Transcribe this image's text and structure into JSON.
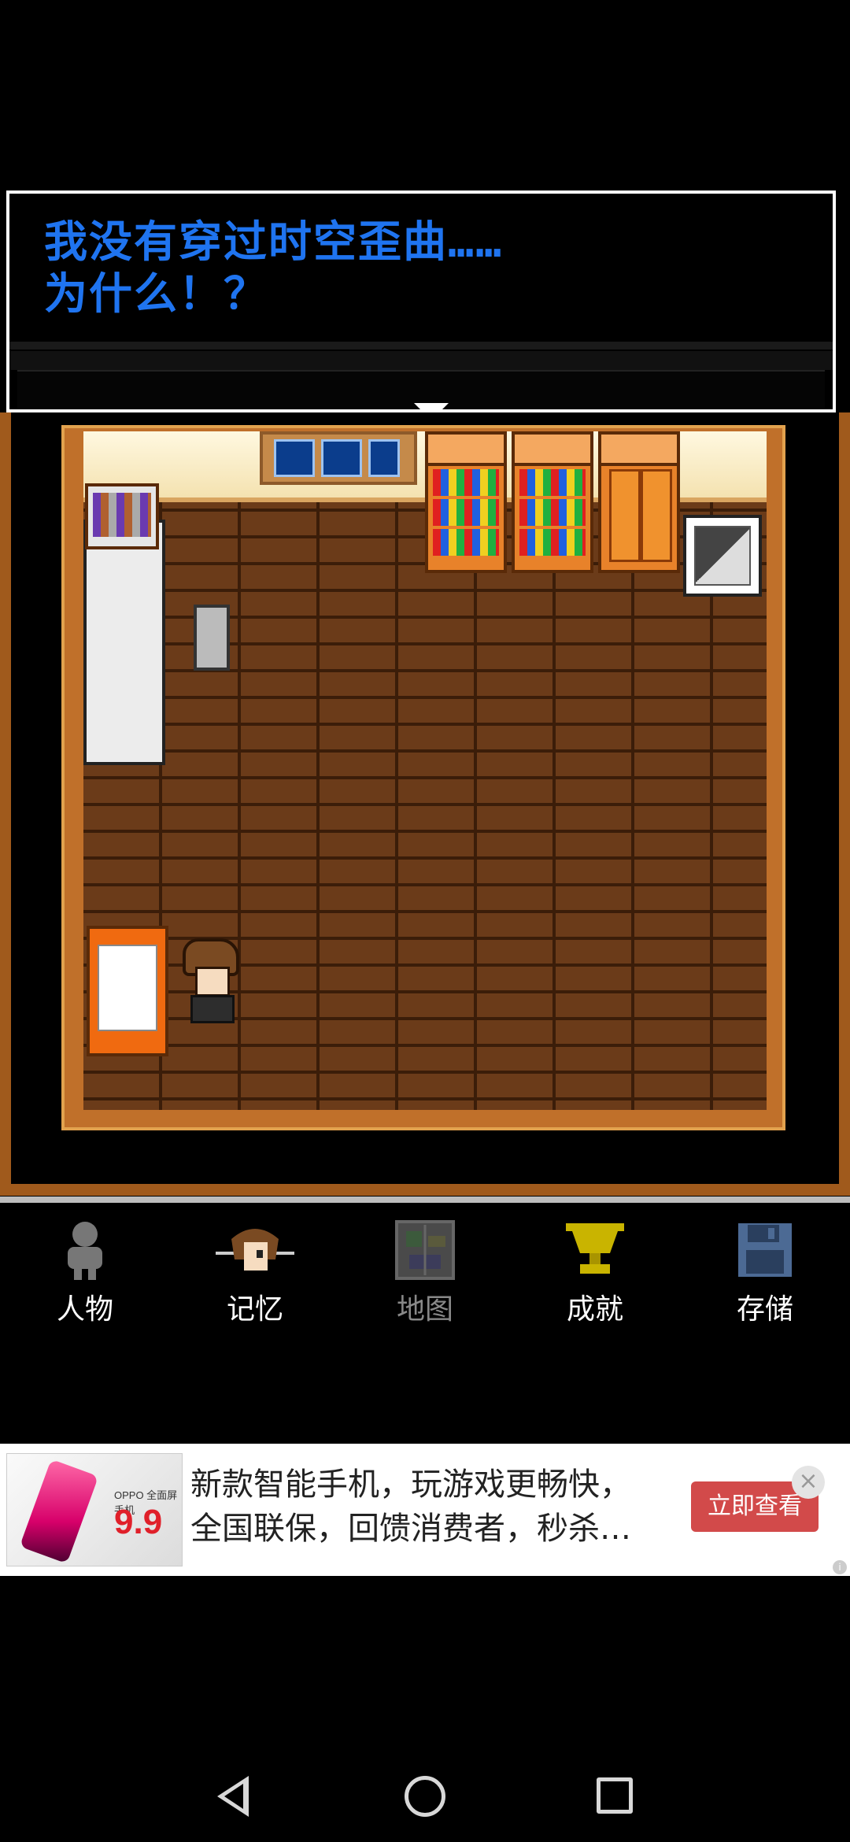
{
  "dialog": {
    "line1": "我没有穿过时空歪曲……",
    "line2": "为什么！？"
  },
  "menu": {
    "items": [
      {
        "label": "人物",
        "icon": "character-icon",
        "enabled": true
      },
      {
        "label": "记忆",
        "icon": "memory-icon",
        "enabled": true
      },
      {
        "label": "地图",
        "icon": "map-icon",
        "enabled": false
      },
      {
        "label": "成就",
        "icon": "trophy-icon",
        "enabled": true
      },
      {
        "label": "存储",
        "icon": "save-disk-icon",
        "enabled": true
      }
    ]
  },
  "ad": {
    "image_brand": "OPPO 全面屏手机",
    "image_price": "9.9",
    "line1": "新款智能手机，玩游戏更畅快，",
    "line2": "全国联保，回馈消费者，秒杀…",
    "cta": "立即查看",
    "close": "×"
  },
  "colors": {
    "dialog_text": "#1f74f0",
    "menu_text": "#ffffff",
    "menu_disabled": "#888888",
    "trophy": "#c9b400",
    "cta_bg": "#d24a4a"
  },
  "navbar": {
    "icons": [
      "back-icon",
      "home-icon",
      "recents-icon"
    ]
  }
}
